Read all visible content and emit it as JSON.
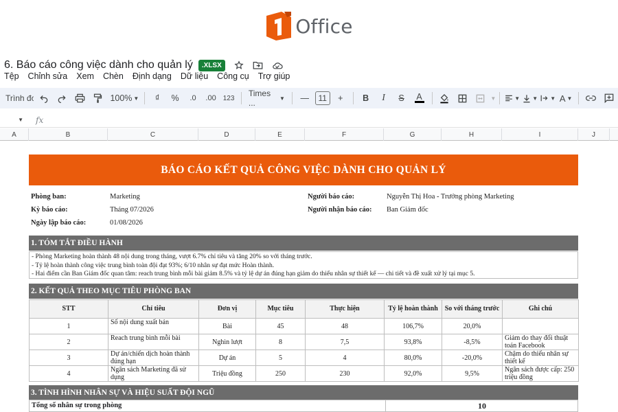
{
  "logo": {
    "text": "Office",
    "brand_color": "#ea5b0c"
  },
  "document": {
    "title": "6. Báo cáo công việc dành cho quản lý",
    "badge": ".XLSX",
    "icons": [
      "star-icon",
      "move-folder-icon",
      "cloud-icon"
    ]
  },
  "menu": [
    "Tệp",
    "Chỉnh sửa",
    "Xem",
    "Chèn",
    "Định dạng",
    "Dữ liệu",
    "Công cụ",
    "Trợ giúp"
  ],
  "toolbar": {
    "search": "Trình đơn",
    "zoom": "100%",
    "currency": "₫",
    "percent": "%",
    "decrease_decimal": ".0",
    "increase_decimal": ".00",
    "number_format": "123",
    "font": "Times ...",
    "font_size": "11"
  },
  "formula": {
    "fx": "fx"
  },
  "columns": [
    "A",
    "B",
    "C",
    "D",
    "E",
    "F",
    "G",
    "H",
    "I",
    "J"
  ],
  "report": {
    "banner": "BÁO CÁO KẾT QUẢ CÔNG VIỆC DÀNH CHO QUẢN LÝ",
    "dept_label": "Phòng ban:",
    "dept_value": "Marketing",
    "period_label": "Kỳ báo cáo:",
    "period_value": "Tháng 07/2026",
    "date_label": "Ngày lập báo cáo:",
    "date_value": "01/08/2026",
    "reporter_label": "Người báo cáo:",
    "reporter_value": "Nguyễn Thị Hoa - Trưởng phòng Marketing",
    "receiver_label": "Người nhận báo cáo:",
    "receiver_value": "Ban Giám đốc",
    "section1": "1. TÓM TẮT ĐIỀU HÀNH",
    "summary": [
      "- Phòng Marketing hoàn thành 48 nội dung trong tháng, vượt 6.7% chỉ tiêu và tăng 20% so với tháng trước.",
      "- Tỷ lệ hoàn thành công việc trung bình toàn đội đạt 93%; 6/10 nhân sự đạt mức Hoàn thành.",
      "- Hai điểm cần Ban Giám đốc quan tâm: reach trung bình mỗi bài giảm 8.5% và tỷ lệ dự án đúng hạn giảm do thiếu nhân sự thiết kế — chi tiết và đề xuất xử lý tại mục 5."
    ],
    "section2": "2. KẾT QUẢ THEO MỤC TIÊU PHÒNG BAN",
    "table_headers": [
      "STT",
      "Chỉ tiêu",
      "Đơn vị",
      "Mục tiêu",
      "Thực hiện",
      "Tỷ lệ hoàn thành",
      "So với tháng trước",
      "Ghi chú"
    ],
    "rows": [
      {
        "stt": "1",
        "metric": "Số nội dung xuất bản",
        "unit": "Bài",
        "target": "45",
        "actual": "48",
        "rate": "106,7%",
        "mom": "20,0%",
        "note": ""
      },
      {
        "stt": "2",
        "metric": "Reach trung bình mỗi bài",
        "unit": "Nghìn lượt",
        "target": "8",
        "actual": "7,5",
        "rate": "93,8%",
        "mom": "-8,5%",
        "note": "Giảm do thay đổi thuật toán Facebook"
      },
      {
        "stt": "3",
        "metric": "Dự án/chiến dịch hoàn thành đúng hạn",
        "unit": "Dự án",
        "target": "5",
        "actual": "4",
        "rate": "80,0%",
        "mom": "-20,0%",
        "note": "Chậm do thiếu nhân sự thiết kế"
      },
      {
        "stt": "4",
        "metric": "Ngân sách Marketing đã sử dụng",
        "unit": "Triệu đồng",
        "target": "250",
        "actual": "230",
        "rate": "92,0%",
        "mom": "9,5%",
        "note": "Ngân sách được cấp: 250 triệu đồng"
      }
    ],
    "section3": "3. TÌNH HÌNH NHÂN SỰ VÀ HIỆU SUẤT ĐỘI NGŨ",
    "staff_label": "Tổng số nhân sự trong phòng",
    "staff_value": "10"
  }
}
